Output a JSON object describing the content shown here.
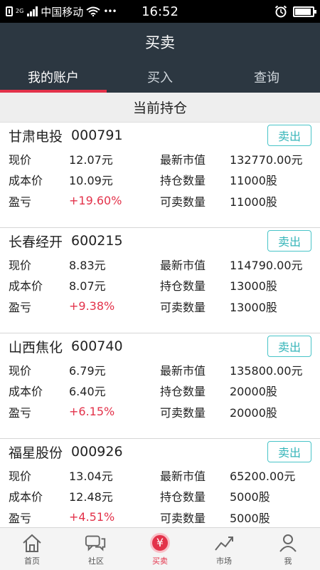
{
  "status_bar": {
    "network": "2G",
    "carrier": "中国移动",
    "time": "16:52"
  },
  "header": {
    "title": "买卖"
  },
  "tabs": [
    {
      "label": "我的账户",
      "active": true
    },
    {
      "label": "买入",
      "active": false
    },
    {
      "label": "查询",
      "active": false
    }
  ],
  "section": {
    "title": "当前持仓"
  },
  "labels": {
    "current_price": "现价",
    "cost_price": "成本价",
    "profit_loss": "盈亏",
    "market_value": "最新市值",
    "position_qty": "持仓数量",
    "sellable_qty": "可卖数量",
    "sell": "卖出"
  },
  "holdings": [
    {
      "name": "甘肃电投",
      "code": "000791",
      "current_price": "12.07元",
      "cost_price": "10.09元",
      "profit_loss": "+19.60%",
      "market_value": "132770.00元",
      "position_qty": "11000股",
      "sellable_qty": "11000股"
    },
    {
      "name": "长春经开",
      "code": "600215",
      "current_price": "8.83元",
      "cost_price": "8.07元",
      "profit_loss": "+9.38%",
      "market_value": "114790.00元",
      "position_qty": "13000股",
      "sellable_qty": "13000股"
    },
    {
      "name": "山西焦化",
      "code": "600740",
      "current_price": "6.79元",
      "cost_price": "6.40元",
      "profit_loss": "+6.15%",
      "market_value": "135800.00元",
      "position_qty": "20000股",
      "sellable_qty": "20000股"
    },
    {
      "name": "福星股份",
      "code": "000926",
      "current_price": "13.04元",
      "cost_price": "12.48元",
      "profit_loss": "+4.51%",
      "market_value": "65200.00元",
      "position_qty": "5000股",
      "sellable_qty": "5000股"
    }
  ],
  "bottom_nav": [
    {
      "label": "首页",
      "icon": "home-icon",
      "active": false
    },
    {
      "label": "社区",
      "icon": "chat-bubbles-icon",
      "active": false
    },
    {
      "label": "买卖",
      "icon": "yuan-coin-icon",
      "active": true
    },
    {
      "label": "市场",
      "icon": "trend-chart-icon",
      "active": false
    },
    {
      "label": "我",
      "icon": "person-icon",
      "active": false
    }
  ],
  "icons": {
    "trade_glyph": "¥"
  },
  "colors": {
    "header_bg": "#2c3741",
    "accent_red": "#e3324a",
    "sell_teal": "#36b5b9"
  },
  "battery_level": 0.9
}
